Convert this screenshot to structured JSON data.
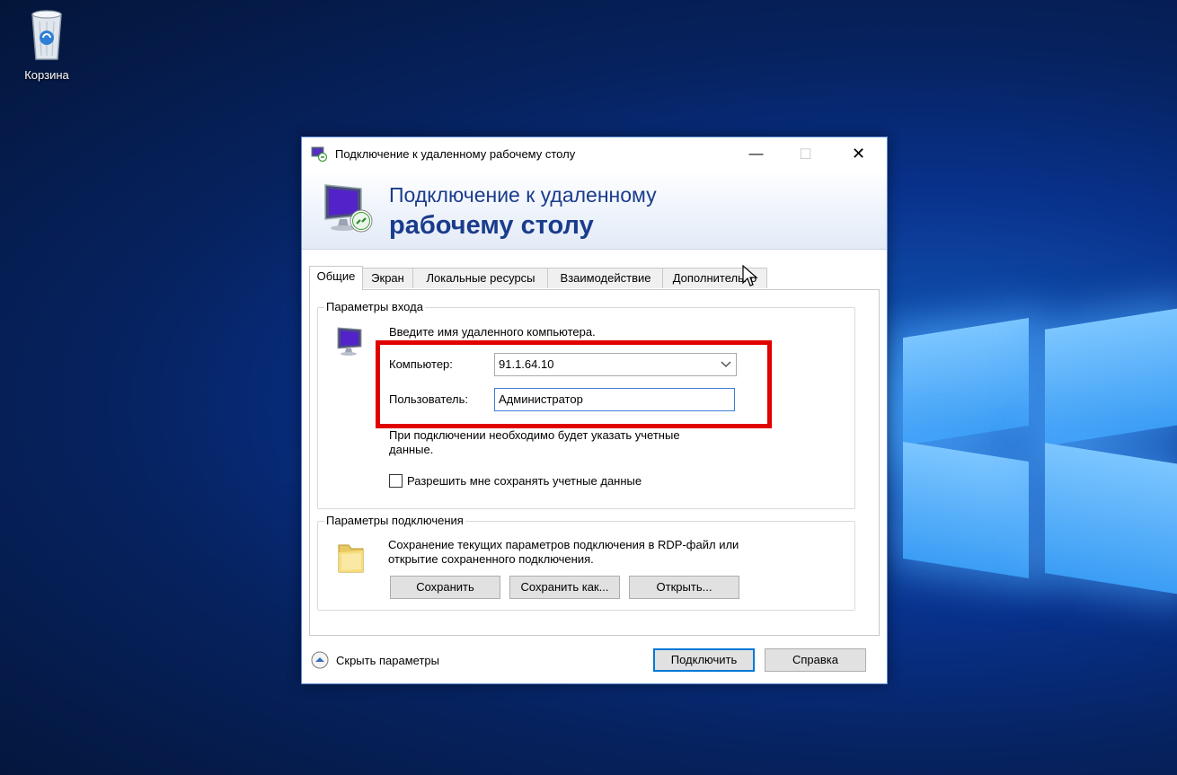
{
  "desktop": {
    "recycle_bin_label": "Корзина"
  },
  "window": {
    "title": "Подключение к удаленному рабочему столу",
    "controls": {
      "minimize": "—",
      "maximize": "☐",
      "close": "✕"
    },
    "banner": {
      "line1": "Подключение к удаленному",
      "line2": "рабочему столу"
    },
    "tabs": [
      "Общие",
      "Экран",
      "Локальные ресурсы",
      "Взаимодействие",
      "Дополнительно"
    ],
    "active_tab": "Общие",
    "login_group": {
      "title": "Параметры входа",
      "instruction": "Введите имя удаленного компьютера.",
      "computer_label": "Компьютер:",
      "computer_value": "91.1.64.10",
      "user_label": "Пользователь:",
      "user_value": "Администратор",
      "note_line1": "При подключении необходимо будет указать учетные",
      "note_line2": "данные.",
      "save_creds_label": "Разрешить мне сохранять учетные данные",
      "save_creds_checked": false
    },
    "connection_group": {
      "title": "Параметры подключения",
      "desc_line1": "Сохранение текущих параметров подключения в RDP-файл или",
      "desc_line2": "открытие сохраненного подключения.",
      "save_button": "Сохранить",
      "save_as_button": "Сохранить как...",
      "open_button": "Открыть..."
    },
    "footer": {
      "hide_options": "Скрыть параметры",
      "connect_button": "Подключить",
      "help_button": "Справка"
    }
  },
  "colors": {
    "highlight_box": "#e00000",
    "banner_text": "#1a3c8c",
    "focus_border": "#3c7fd6"
  }
}
